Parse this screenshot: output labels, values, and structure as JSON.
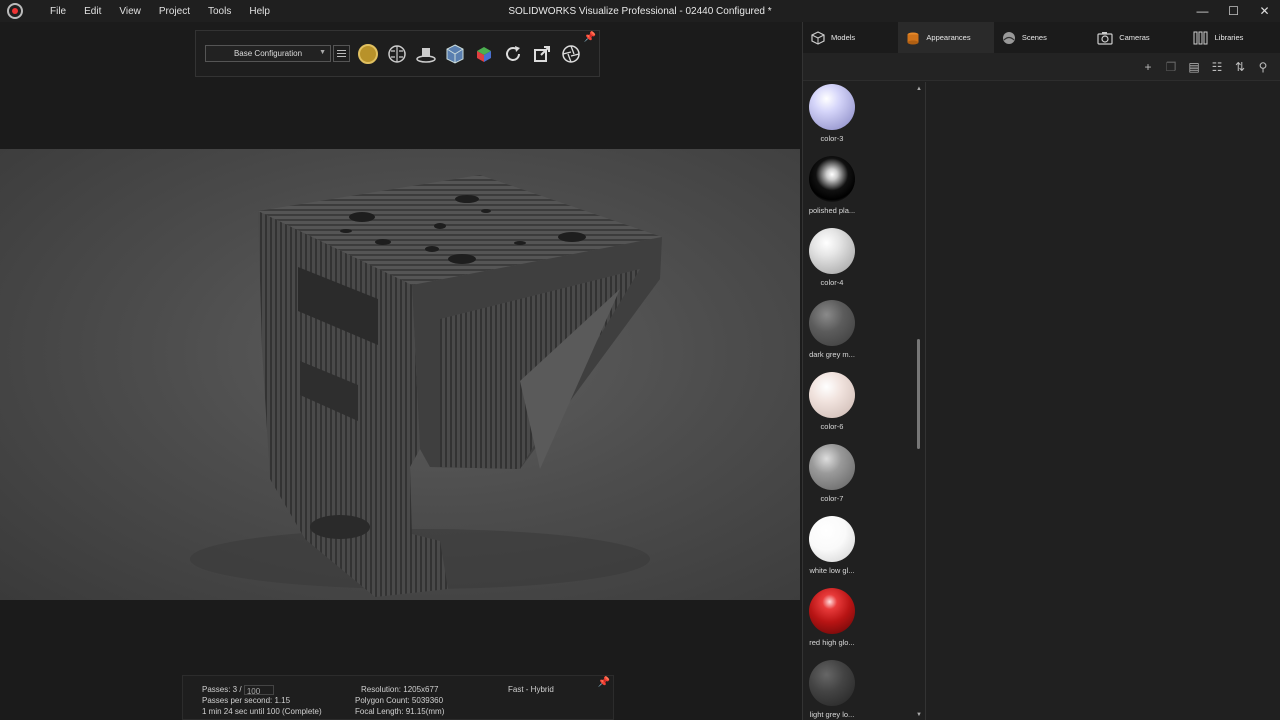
{
  "menu": [
    "File",
    "Edit",
    "View",
    "Project",
    "Tools",
    "Help"
  ],
  "window_title": "SOLIDWORKS Visualize Professional - 02440 Configured *",
  "window_controls": {
    "minimize": "—",
    "maximize": "☐",
    "close": "✕"
  },
  "toolbar": {
    "configuration": "Base Configuration",
    "icons": [
      "material-sphere-icon",
      "brain-icon",
      "turntable-icon",
      "cube-icon",
      "color-cube-icon",
      "refresh-icon",
      "export-icon",
      "aperture-icon"
    ]
  },
  "status": {
    "passes_label": "Passes: 3 /",
    "passes_value": "100",
    "passes_per_second": "Passes per second: 1.15",
    "time_remaining": "1 min 24 sec until 100 (Complete)",
    "resolution": "Resolution: 1205x677",
    "polygon_count": "Polygon Count: 5039360",
    "focal_length": "Focal Length: 91.15(mm)",
    "render_mode": "Fast - Hybrid"
  },
  "panel": {
    "tabs": [
      {
        "label": "Models",
        "icon": "cube-icon",
        "active": false
      },
      {
        "label": "Appearances",
        "icon": "paint-can-icon",
        "active": true
      },
      {
        "label": "Scenes",
        "icon": "globe-icon",
        "active": false
      },
      {
        "label": "Cameras",
        "icon": "camera-icon",
        "active": false
      },
      {
        "label": "Libraries",
        "icon": "books-icon",
        "active": false
      }
    ],
    "tools": [
      "add-icon",
      "copy-icon",
      "layout-icon",
      "grid-icon",
      "sort-icon",
      "search-icon"
    ],
    "appearances": [
      {
        "name": "color-3",
        "color": "#c9c9f2"
      },
      {
        "name": "polished pla...",
        "color": "#1a1a1a"
      },
      {
        "name": "color-4",
        "color": "#d6d6d6"
      },
      {
        "name": "dark grey m...",
        "color": "#555555"
      },
      {
        "name": "color-6",
        "color": "#ecdcd6"
      },
      {
        "name": "color-7",
        "color": "#8e8e8e"
      },
      {
        "name": "white low gl...",
        "color": "#f6f6f6"
      },
      {
        "name": "red high glo...",
        "color": "#c81e1e"
      },
      {
        "name": "light grey lo...",
        "color": "#3e3e3e"
      }
    ]
  }
}
